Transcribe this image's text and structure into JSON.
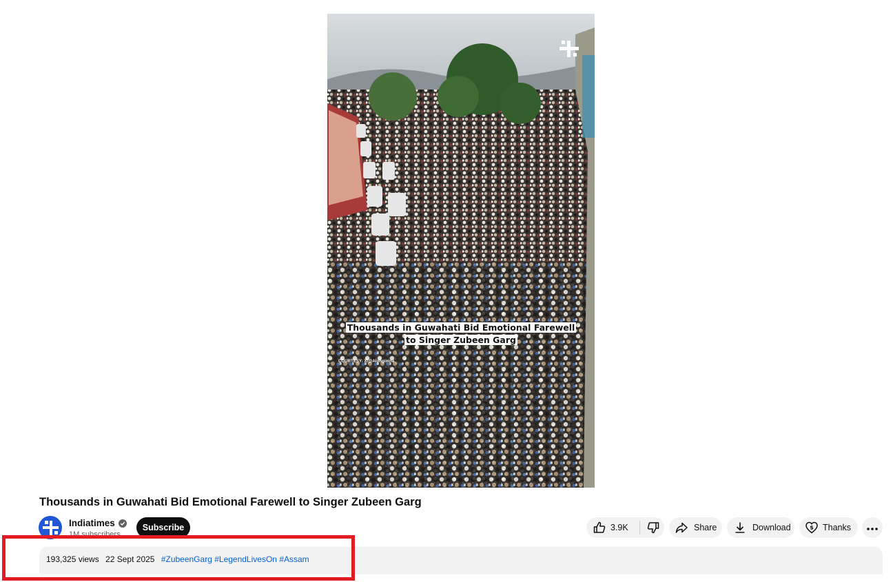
{
  "video": {
    "caption_line1": "Thousands in Guwahati Bid Emotional Farewell",
    "caption_line2": "to Singer Zubeen Garg",
    "courtesy": "COURTESY: X/@Alongimna"
  },
  "title": "Thousands in Guwahati Bid Emotional Farewell to Singer Zubeen Garg",
  "channel": {
    "name": "Indiatimes",
    "subscribers": "1M subscribers",
    "subscribe_label": "Subscribe"
  },
  "actions": {
    "like_count": "3.9K",
    "share_label": "Share",
    "download_label": "Download",
    "thanks_label": "Thanks"
  },
  "description": {
    "views": "193,325 views",
    "date": "22 Sept 2025",
    "hashtags": [
      "#ZubeenGarg",
      "#LegendLivesOn",
      "#Assam"
    ]
  },
  "colors": {
    "highlight": "#e31b23",
    "link": "#065fd4",
    "channel_avatar": "#1f57d6"
  },
  "icons": [
    "like-icon",
    "dislike-icon",
    "share-icon",
    "download-icon",
    "thanks-icon",
    "more-icon",
    "verified-icon"
  ]
}
